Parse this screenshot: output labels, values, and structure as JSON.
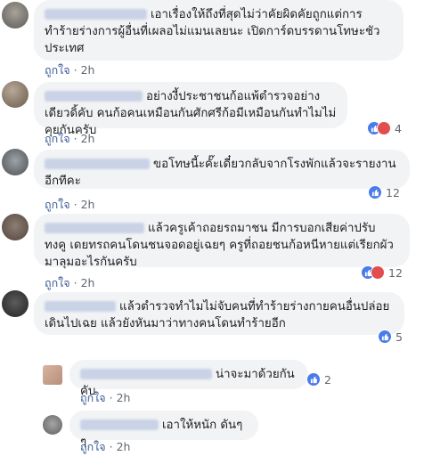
{
  "comments": [
    {
      "text": "เอาเรื่องให้ถึงที่สุดไม่ว่าคัยผิดคัยถูกแต่การทำร้ายร่างการผู้อื่นที่เผลอไม่แมนเลยนะ เปิดการ์ดบรรดานโทษะชัวประเทศ",
      "like_label": "ถูกใจ",
      "time": "2h",
      "reactions": null
    },
    {
      "text": "อย่างงี้ประชาชนก้อแพ้ตำรวจอย่างเดียวดิ้คับ คนก้อคนเหมือนกันศักศรีก้อมีเหมือนกันทำไมไม่คุยกันครับ",
      "like_label": "ถูกใจ",
      "time": "2h",
      "reactions": {
        "icons": [
          "like-icon",
          "haha-icon"
        ],
        "count": "4"
      }
    },
    {
      "text": "ขอโทษนี้ะคั๊ะเดี๋ยวกลับจากโรงพักแล้วจะรายงานอีกทีคะ",
      "like_label": "ถูกใจ",
      "time": "2h",
      "reactions": {
        "icons": [
          "like-icon"
        ],
        "count": "12"
      }
    },
    {
      "text": "แล้วครูเค้าถอยรถมาชน มีการบอกเสียค่าปรับ ทงคู เดยทรถคนโดนชนจอดอยู่เฉยๆ ครูที่ถอยชนก้อหนีหายแต่เรียกผัวมาลุมอะไรกันครับ",
      "like_label": "ถูกใจ",
      "time": "2h",
      "reactions": {
        "icons": [
          "like-icon",
          "angry-icon"
        ],
        "count": "12"
      }
    },
    {
      "text": "แล้วตำรวจทำไมไม่จับคนที่ทำร้ายร่างกายคนอื่นปล่อยเดินไปเฉย แล้วยังหันมาว่าทางคนโดนทำร้ายอีก",
      "like_label": "",
      "time": "",
      "reactions": {
        "icons": [
          "like-icon"
        ],
        "count": "5"
      }
    }
  ],
  "replies": [
    {
      "text": "น่าจะมาด้วยกันคับ",
      "like_label": "ถูกใจ",
      "time": "2h",
      "reactions": {
        "icons": [
          "like-icon"
        ],
        "count": "2"
      }
    },
    {
      "text": "เอาให้หนัก ดันๆๆ",
      "like_label": "ถูกใจ",
      "time": "2h",
      "reactions": null
    }
  ],
  "colors": {
    "bubble_bg": "#f2f3f5",
    "link_blue": "#385898",
    "meta_gray": "#616770",
    "like_blue": "#4a7bea",
    "haha_yellow": "#f5c33b",
    "angry_orange": "#e9710f"
  }
}
